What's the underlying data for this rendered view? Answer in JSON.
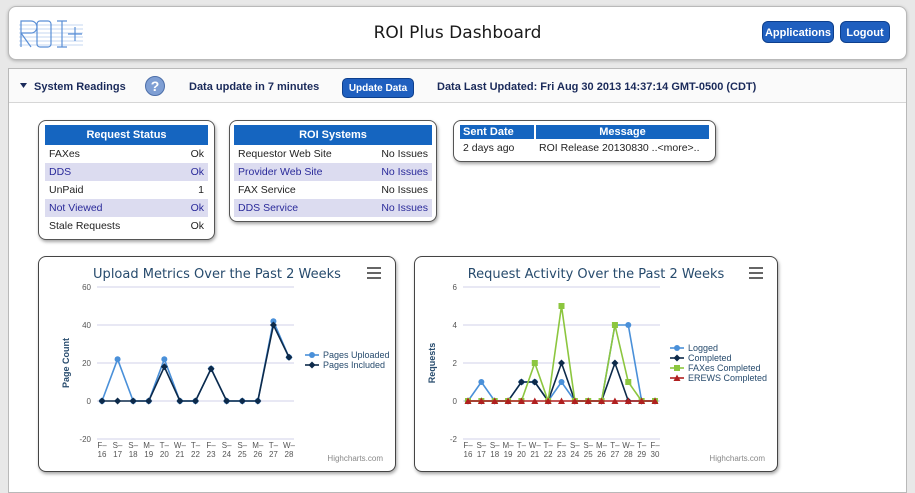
{
  "header": {
    "logo_text": "ROI+",
    "title": "ROI Plus Dashboard",
    "applications_label": "Applications",
    "logout_label": "Logout"
  },
  "toolbar": {
    "section_label": "System Readings",
    "help_label": "?",
    "update_in": "Data update in 7  minutes",
    "update_button": "Update Data",
    "last_updated": "Data Last Updated:  Fri Aug 30 2013 14:37:14 GMT-0500 (CDT)"
  },
  "request_status": {
    "title": "Request Status",
    "rows": [
      {
        "label": "FAXes",
        "value": "Ok"
      },
      {
        "label": "DDS",
        "value": "Ok"
      },
      {
        "label": "UnPaid",
        "value": "1"
      },
      {
        "label": "Not Viewed",
        "value": "Ok"
      },
      {
        "label": "Stale Requests",
        "value": "Ok"
      }
    ]
  },
  "roi_systems": {
    "title": "ROI Systems",
    "rows": [
      {
        "label": "Requestor Web Site",
        "value": "No Issues"
      },
      {
        "label": "Provider Web Site",
        "value": "No Issues"
      },
      {
        "label": "FAX Service",
        "value": "No Issues"
      },
      {
        "label": "DDS Service",
        "value": "No Issues"
      }
    ]
  },
  "messages": {
    "col_date": "Sent Date",
    "col_message": "Message",
    "rows": [
      {
        "date": "2 days ago",
        "message": "ROI Release 20130830   ..<more>.."
      }
    ]
  },
  "colors": {
    "accent": "#1565c0",
    "series_blue": "#4a90d9",
    "series_navy": "#0d2a4a",
    "series_green": "#8cc63f",
    "series_red": "#b02020"
  },
  "chart_data": [
    {
      "type": "line",
      "title": "Upload Metrics Over the Past 2 Weeks",
      "xlabel": "",
      "ylabel": "Page Count",
      "ylim": [
        -20,
        60
      ],
      "yticks": [
        -20,
        0,
        20,
        40,
        60
      ],
      "grid": true,
      "legend": "right",
      "categories": [
        [
          "F–",
          "16"
        ],
        [
          "S–",
          "17"
        ],
        [
          "S–",
          "18"
        ],
        [
          "M–",
          "19"
        ],
        [
          "T–",
          "20"
        ],
        [
          "W–",
          "21"
        ],
        [
          "T–",
          "22"
        ],
        [
          "F–",
          "23"
        ],
        [
          "S–",
          "24"
        ],
        [
          "S–",
          "25"
        ],
        [
          "M–",
          "26"
        ],
        [
          "T–",
          "27"
        ],
        [
          "W–",
          "28"
        ]
      ],
      "series": [
        {
          "name": "Pages Uploaded",
          "values": [
            0,
            22,
            0,
            0,
            22,
            0,
            0,
            17,
            0,
            0,
            0,
            42,
            23
          ],
          "color": "#4a90d9",
          "marker": "circle"
        },
        {
          "name": "Pages Included",
          "values": [
            0,
            0,
            0,
            0,
            18,
            0,
            0,
            17,
            0,
            0,
            0,
            40,
            23
          ],
          "color": "#0d2a4a",
          "marker": "diamond"
        }
      ],
      "credit": "Highcharts.com",
      "menu_icon": "hamburger-menu-icon"
    },
    {
      "type": "line",
      "title": "Request Activity Over the Past 2 Weeks",
      "xlabel": "",
      "ylabel": "Requests",
      "ylim": [
        -2,
        6
      ],
      "yticks": [
        -2,
        0,
        2,
        4,
        6
      ],
      "grid": true,
      "legend": "right",
      "categories": [
        [
          "F–",
          "16"
        ],
        [
          "S–",
          "17"
        ],
        [
          "S–",
          "18"
        ],
        [
          "M–",
          "19"
        ],
        [
          "T–",
          "20"
        ],
        [
          "W–",
          "21"
        ],
        [
          "T–",
          "22"
        ],
        [
          "F–",
          "23"
        ],
        [
          "S–",
          "24"
        ],
        [
          "S–",
          "25"
        ],
        [
          "M–",
          "26"
        ],
        [
          "T–",
          "27"
        ],
        [
          "W–",
          "28"
        ],
        [
          "T–",
          "29"
        ],
        [
          "F–",
          "30"
        ]
      ],
      "series": [
        {
          "name": "Logged",
          "values": [
            0,
            1,
            0,
            0,
            1,
            1,
            0,
            1,
            0,
            0,
            0,
            4,
            4,
            0,
            0
          ],
          "color": "#4a90d9",
          "marker": "circle"
        },
        {
          "name": "Completed",
          "values": [
            0,
            0,
            0,
            0,
            1,
            1,
            0,
            2,
            0,
            0,
            0,
            2,
            0,
            0,
            0
          ],
          "color": "#0d2a4a",
          "marker": "diamond"
        },
        {
          "name": "FAXes Completed",
          "values": [
            0,
            0,
            0,
            0,
            0,
            2,
            0,
            5,
            0,
            0,
            0,
            4,
            1,
            0,
            0
          ],
          "color": "#8cc63f",
          "marker": "square"
        },
        {
          "name": "EREWS Completed",
          "values": [
            0,
            0,
            0,
            0,
            0,
            0,
            0,
            0,
            0,
            0,
            0,
            0,
            0,
            0,
            0
          ],
          "color": "#b02020",
          "marker": "triangle"
        }
      ],
      "credit": "Highcharts.com",
      "menu_icon": "hamburger-menu-icon"
    }
  ]
}
